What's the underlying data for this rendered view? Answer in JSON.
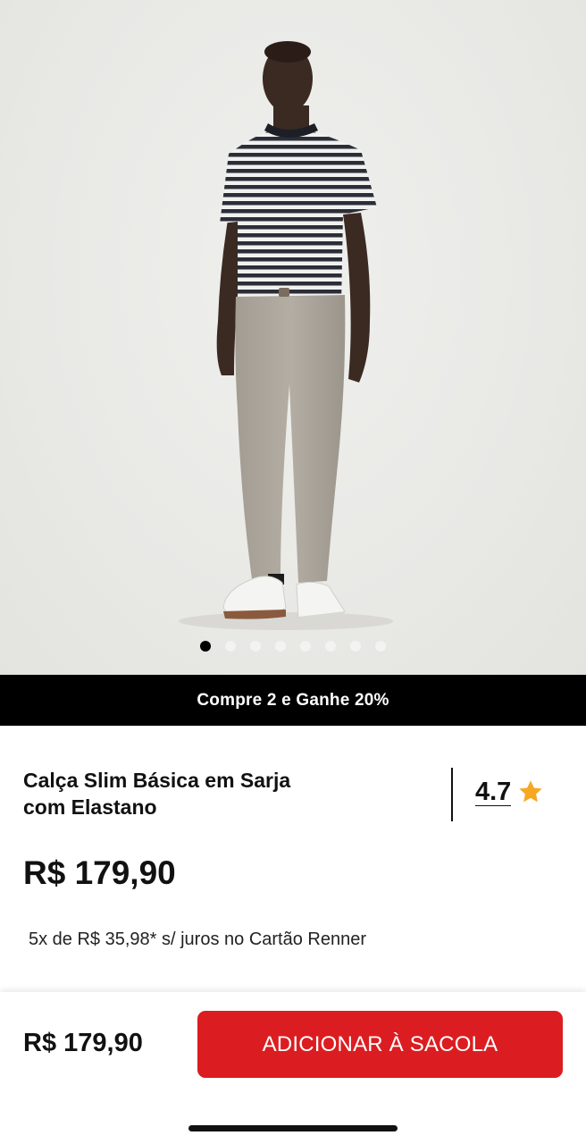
{
  "gallery": {
    "image_alt": "model-wearing-slim-chino",
    "dots_total": 8,
    "active_index": 0
  },
  "promo": {
    "text": "Compre 2 e Ganhe 20%"
  },
  "product": {
    "title": "Calça Slim Básica em Sarja com Elastano",
    "rating": "4.7",
    "rating_icon": "star-icon",
    "price": "R$ 179,90",
    "installments": "5x de R$ 35,98* s/ juros no Cartão Renner"
  },
  "bottom_bar": {
    "price": "R$ 179,90",
    "add_button_label": "ADICIONAR À SACOLA"
  },
  "colors": {
    "accent": "#db1d21",
    "promo_bg": "#000000",
    "star": "#f7a823"
  }
}
